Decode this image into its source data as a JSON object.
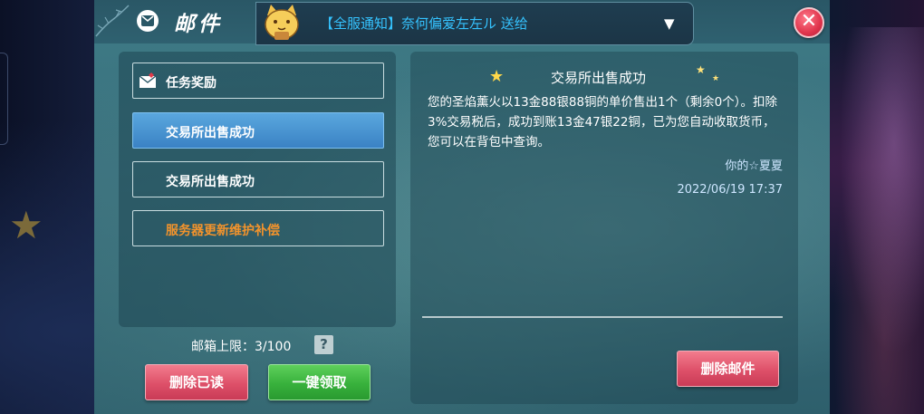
{
  "header": {
    "title": "邮件",
    "announcement": "【全服通知】奈何偏爱左左ル 送给"
  },
  "mail_list": [
    {
      "label": "任务奖励",
      "state": "normal",
      "has_icon": true
    },
    {
      "label": "交易所出售成功",
      "state": "selected"
    },
    {
      "label": "交易所出售成功",
      "state": "normal"
    },
    {
      "label": "服务器更新维护补偿",
      "state": "highlight"
    }
  ],
  "mailbox": {
    "capacity_text": "邮箱上限：3/100",
    "help_label": "?"
  },
  "buttons": {
    "delete_read": "删除已读",
    "claim_all": "一键领取",
    "delete_mail": "删除邮件"
  },
  "detail": {
    "title": "交易所出售成功",
    "body": "您的圣焰薰火以13金88银88铜的单价售出1个（剩余0个）。扣除3%交易税后，成功到账13金47银22铜，已为您自动收取货币，您可以在背包中查询。",
    "sender": "你的☆夏夏",
    "date": "2022/06/19 17:37"
  },
  "colors": {
    "announcement": "#35c3ff",
    "highlight_item": "#f2932c",
    "selected_item": "#4a95d2",
    "danger_button": "#de5069",
    "confirm_button": "#38b13c"
  }
}
